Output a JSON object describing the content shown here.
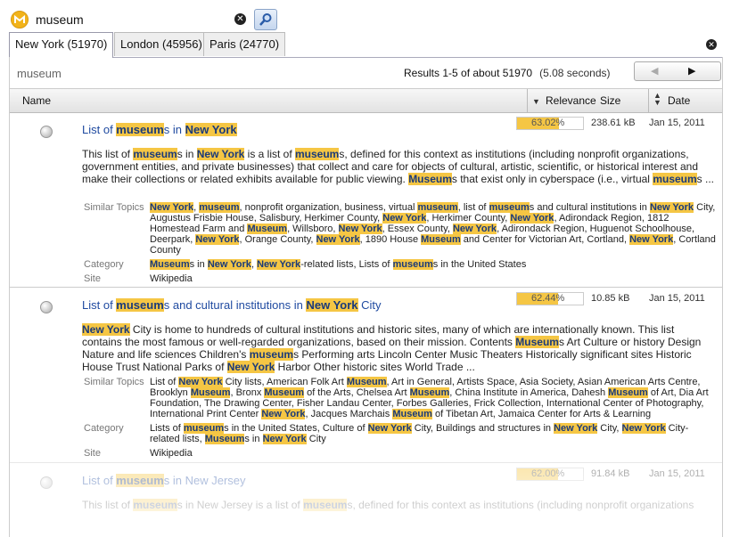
{
  "search": {
    "value": "museum"
  },
  "tabs": [
    {
      "label": "New York (51970)"
    },
    {
      "label": "London (45956)"
    },
    {
      "label": "Paris (24770)"
    }
  ],
  "results_header": {
    "query": "museum",
    "count_text": "Results 1-5 of about 51970",
    "time_text": "(5.08 seconds)"
  },
  "columns": {
    "name": "Name",
    "relevance": "Relevance",
    "size": "Size",
    "date": "Date"
  },
  "meta_labels": {
    "topics": "Similar Topics",
    "category": "Category",
    "site": "Site"
  },
  "results": [
    {
      "title": [
        "List of ",
        "museum",
        "s in ",
        "New York"
      ],
      "relevance": 63.02,
      "relevance_text": "63.02%",
      "size": "238.61 kB",
      "date": "Jan 15, 2011",
      "snippet": [
        "This list of ",
        "museum",
        "s in ",
        "New York",
        " is a list of ",
        "museum",
        "s, defined for this context as institutions (including nonprofit organizations, government entities, and private businesses) that collect and care for objects of cultural, artistic, scientific, or historical interest and make their collections or related exhibits available for public viewing. ",
        "Museum",
        "s that exist only in cyberspace (i.e., virtual ",
        "museum",
        "s ..."
      ],
      "topics": [
        "",
        "New York",
        ", ",
        "museum",
        ", nonprofit organization, business, virtual ",
        "museum",
        ", list of ",
        "museum",
        "s and cultural institutions in ",
        "New York",
        " City, Augustus Frisbie House, Salisbury, Herkimer County, ",
        "New York",
        ", Herkimer County, ",
        "New York",
        ", Adirondack Region, 1812 Homestead Farm and ",
        "Museum",
        ", Willsboro, ",
        "New York",
        ", Essex County, ",
        "New York",
        ", Adirondack Region, Huguenot Schoolhouse, Deerpark, ",
        "New York",
        ", Orange County, ",
        "New York",
        ", 1890 House ",
        "Museum",
        " and Center for Victorian Art, Cortland, ",
        "New York",
        ", Cortland County"
      ],
      "category": [
        "",
        "Museum",
        "s in ",
        "New York",
        ", ",
        "New York",
        "-related lists, Lists of ",
        "museum",
        "s in the United States"
      ],
      "site": "Wikipedia"
    },
    {
      "title": [
        "List of ",
        "museum",
        "s and cultural institutions in ",
        "New York",
        " City"
      ],
      "relevance": 62.44,
      "relevance_text": "62.44%",
      "size": "10.85 kB",
      "date": "Jan 15, 2011",
      "snippet": [
        "",
        "New York",
        " City is home to hundreds of cultural institutions and historic sites, many of which are internationally known. This list contains the most famous or well-regarded organizations, based on their mission. Contents ",
        "Museum",
        "s Art Culture or history Design Nature and life sciences Children's ",
        "museum",
        "s Performing arts Lincoln Center Music Theaters Historically significant sites Historic House Trust National Parks of ",
        "New York",
        " Harbor Other historic sites World Trade ..."
      ],
      "topics": [
        "List of ",
        "New York",
        " City lists, American Folk Art ",
        "Museum",
        ", Art in General, Artists Space, Asia Society, Asian American Arts Centre, Brooklyn ",
        "Museum",
        ", Bronx ",
        "Museum",
        " of the Arts, Chelsea Art ",
        "Museum",
        ", China Institute in America, Dahesh ",
        "Museum",
        " of Art, Dia Art Foundation, The Drawing Center, Fisher Landau Center, Forbes Galleries, Frick Collection, International Center of Photography, International Print Center ",
        "New York",
        ", Jacques Marchais ",
        "Museum",
        " of Tibetan Art, Jamaica Center for Arts & Learning"
      ],
      "category": [
        "Lists of ",
        "museum",
        "s in the United States, Culture of ",
        "New York",
        " City, Buildings and structures in ",
        "New York",
        " City, ",
        "New York",
        " City-related lists, ",
        "Museum",
        "s in ",
        "New York",
        " City"
      ],
      "site": "Wikipedia"
    },
    {
      "title": [
        "List of ",
        "museum",
        "s in New Jersey"
      ],
      "relevance": 62.0,
      "relevance_text": "62.00%",
      "size": "91.84 kB",
      "date": "Jan 15, 2011",
      "snippet": [
        "This list of ",
        "museum",
        "s in New Jersey is a list of ",
        "museum",
        "s, defined for this context as institutions (including nonprofit organizations"
      ],
      "topics": [],
      "category": [],
      "site": ""
    }
  ]
}
